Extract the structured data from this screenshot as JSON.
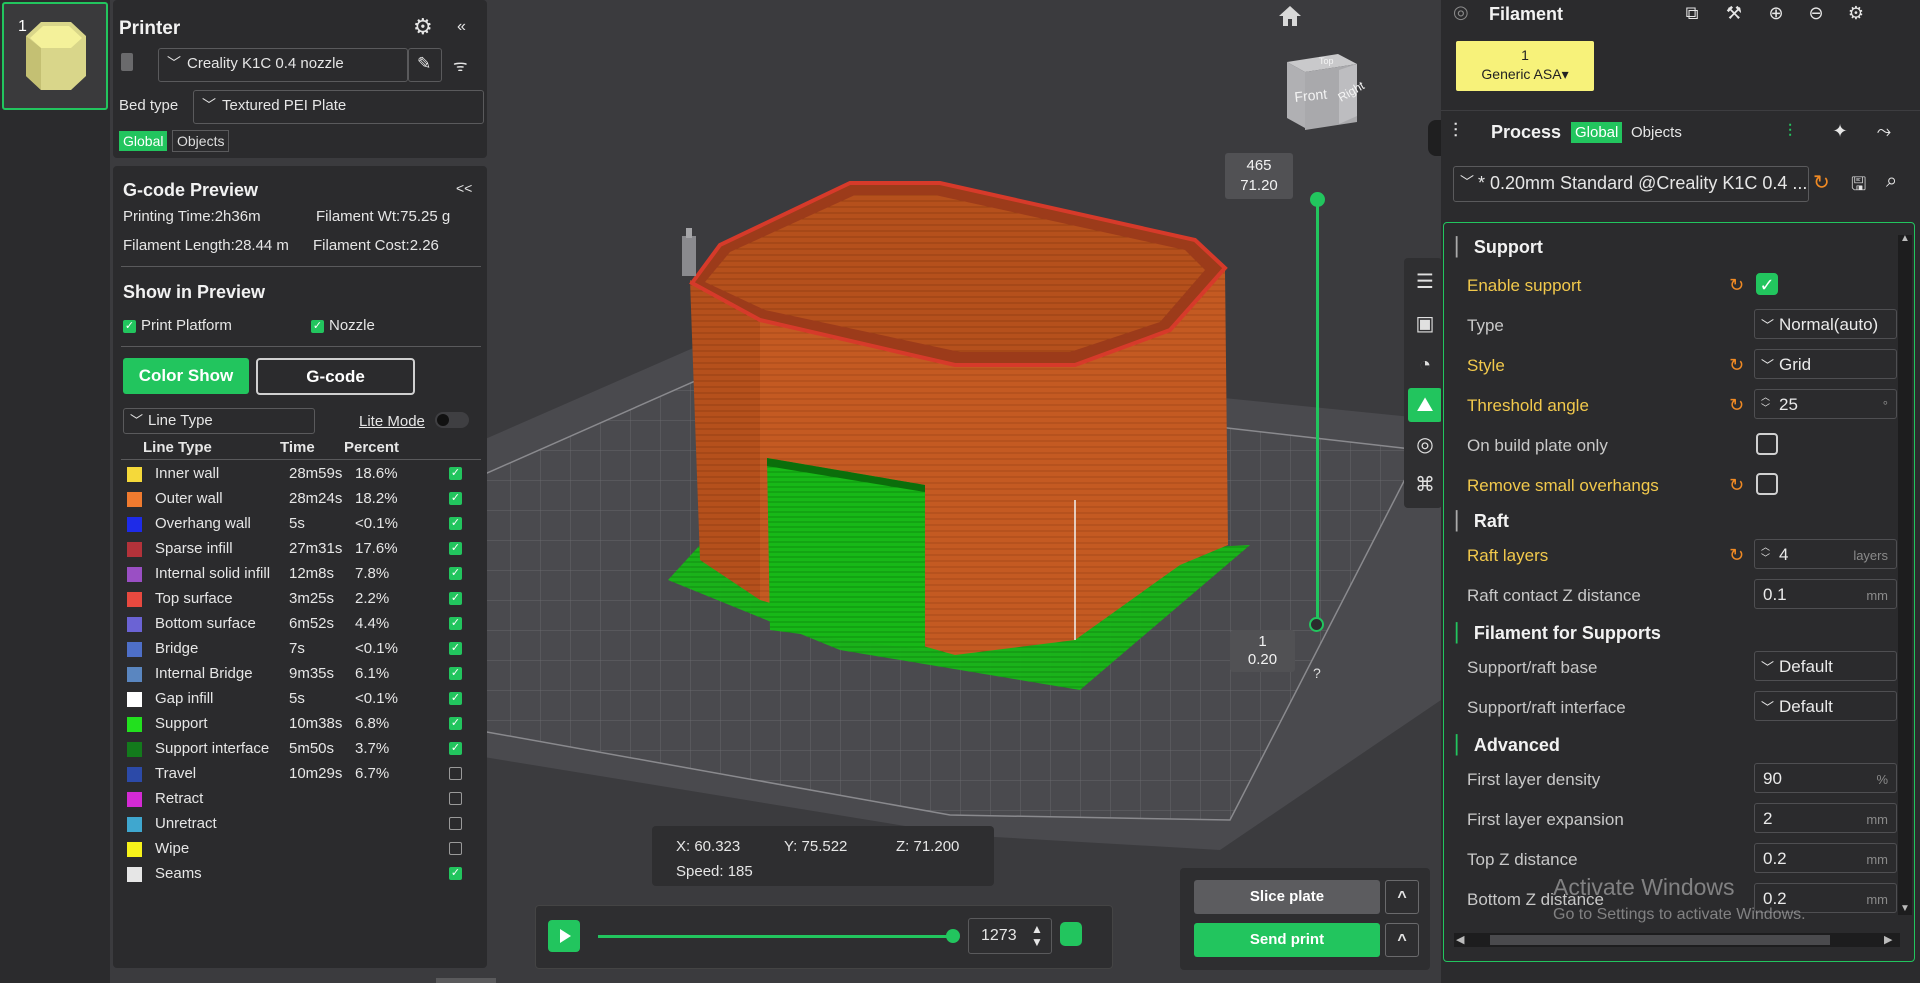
{
  "thumbnail": {
    "index": "1"
  },
  "printer": {
    "title": "Printer",
    "printer_name": "Creality K1C 0.4 nozzle",
    "bed_type_label": "Bed type",
    "bed_type": "Textured PEI Plate",
    "tab_global": "Global",
    "tab_objects": "Objects"
  },
  "gcode": {
    "title": "G-code Preview",
    "collapse": "<<",
    "printing_time": "Printing Time:2h36m",
    "filament_wt": "Filament Wt:75.25 g",
    "filament_length": "Filament Length:28.44 m",
    "filament_cost": "Filament Cost:2.26",
    "show_in_preview": "Show in Preview",
    "print_platform": "Print Platform",
    "nozzle": "Nozzle",
    "color_show": "Color Show",
    "gcode_btn": "G-code",
    "line_type_select": "Line Type",
    "lite_mode": "Lite Mode",
    "col_line_type": "Line Type",
    "col_time": "Time",
    "col_percent": "Percent",
    "rows": [
      {
        "name": "Inner wall",
        "time": "28m59s",
        "percent": "18.6%",
        "color": "#f5d93a",
        "checked": true
      },
      {
        "name": "Outer wall",
        "time": "28m24s",
        "percent": "18.2%",
        "color": "#f07b2f",
        "checked": true
      },
      {
        "name": "Overhang wall",
        "time": "5s",
        "percent": "<0.1%",
        "color": "#1e2be8",
        "checked": true
      },
      {
        "name": "Sparse infill",
        "time": "27m31s",
        "percent": "17.6%",
        "color": "#b3323a",
        "checked": true
      },
      {
        "name": "Internal solid infill",
        "time": "12m8s",
        "percent": "7.8%",
        "color": "#9a4fc4",
        "checked": true
      },
      {
        "name": "Top surface",
        "time": "3m25s",
        "percent": "2.2%",
        "color": "#e8493f",
        "checked": true
      },
      {
        "name": "Bottom surface",
        "time": "6m52s",
        "percent": "4.4%",
        "color": "#6b63d4",
        "checked": true
      },
      {
        "name": "Bridge",
        "time": "7s",
        "percent": "<0.1%",
        "color": "#4e6fc8",
        "checked": true
      },
      {
        "name": "Internal Bridge",
        "time": "9m35s",
        "percent": "6.1%",
        "color": "#5a86c0",
        "checked": true
      },
      {
        "name": "Gap infill",
        "time": "5s",
        "percent": "<0.1%",
        "color": "#ffffff",
        "checked": true
      },
      {
        "name": "Support",
        "time": "10m38s",
        "percent": "6.8%",
        "color": "#22e01e",
        "checked": true
      },
      {
        "name": "Support interface",
        "time": "5m50s",
        "percent": "3.7%",
        "color": "#137a1c",
        "checked": true
      },
      {
        "name": "Travel",
        "time": "10m29s",
        "percent": "6.7%",
        "color": "#2c4aa8",
        "checked": false
      },
      {
        "name": "Retract",
        "time": "",
        "percent": "",
        "color": "#d42ad4",
        "checked": false
      },
      {
        "name": "Unretract",
        "time": "",
        "percent": "",
        "color": "#3fa7cf",
        "checked": false
      },
      {
        "name": "Wipe",
        "time": "",
        "percent": "",
        "color": "#f7f21a",
        "checked": false
      },
      {
        "name": "Seams",
        "time": "",
        "percent": "",
        "color": "#e6e6e6",
        "checked": true
      }
    ]
  },
  "viewport": {
    "layer_top_num": "465",
    "layer_top_height": "71.20",
    "layer_bottom_num": "1",
    "layer_bottom_height": "0.20",
    "help": "?",
    "cube_front": "Front",
    "cube_right": "Right",
    "cube_top": "Top",
    "coord_x": "X: 60.323",
    "coord_y": "Y: 75.522",
    "coord_z": "Z: 71.200",
    "speed": "Speed: 185",
    "move_value": "1273",
    "slice_plate": "Slice plate",
    "send_print": "Send print",
    "caret": "^"
  },
  "right": {
    "filament_title": "Filament",
    "filament_slot_num": "1",
    "filament_slot_name": "Generic ASA",
    "process_title": "Process",
    "tab_global": "Global",
    "tab_objects": "Objects",
    "preset": "* 0.20mm Standard @Creality K1C 0.4 ...",
    "sections": {
      "support": "Support",
      "raft": "Raft",
      "filament_for_supports": "Filament for Supports",
      "advanced": "Advanced"
    },
    "settings": {
      "enable_support": "Enable support",
      "type": "Type",
      "type_val": "Normal(auto)",
      "style": "Style",
      "style_val": "Grid",
      "threshold_angle": "Threshold angle",
      "threshold_val": "25",
      "threshold_unit": "°",
      "on_build_plate_only": "On build plate only",
      "remove_small_overhangs": "Remove small overhangs",
      "raft_layers": "Raft layers",
      "raft_layers_val": "4",
      "raft_layers_unit": "layers",
      "raft_contact_z": "Raft contact Z distance",
      "raft_contact_z_val": "0.1",
      "mm": "mm",
      "support_raft_base": "Support/raft base",
      "support_raft_base_val": "Default",
      "support_raft_interface": "Support/raft interface",
      "support_raft_interface_val": "Default",
      "first_layer_density": "First layer density",
      "first_layer_density_val": "90",
      "percent": "%",
      "first_layer_expansion": "First layer expansion",
      "first_layer_expansion_val": "2",
      "top_z_distance": "Top Z distance",
      "top_z_distance_val": "0.2",
      "bottom_z_distance": "Bottom Z distance",
      "bottom_z_distance_val": "0.2"
    },
    "watermark_1": "Activate Windows",
    "watermark_2": "Go to Settings to activate Windows."
  },
  "colors": {
    "accent": "#22c55e",
    "highlight": "#f2c94c",
    "reset": "#f08a24",
    "model_wall": "#c85a22",
    "support": "#16b816"
  }
}
